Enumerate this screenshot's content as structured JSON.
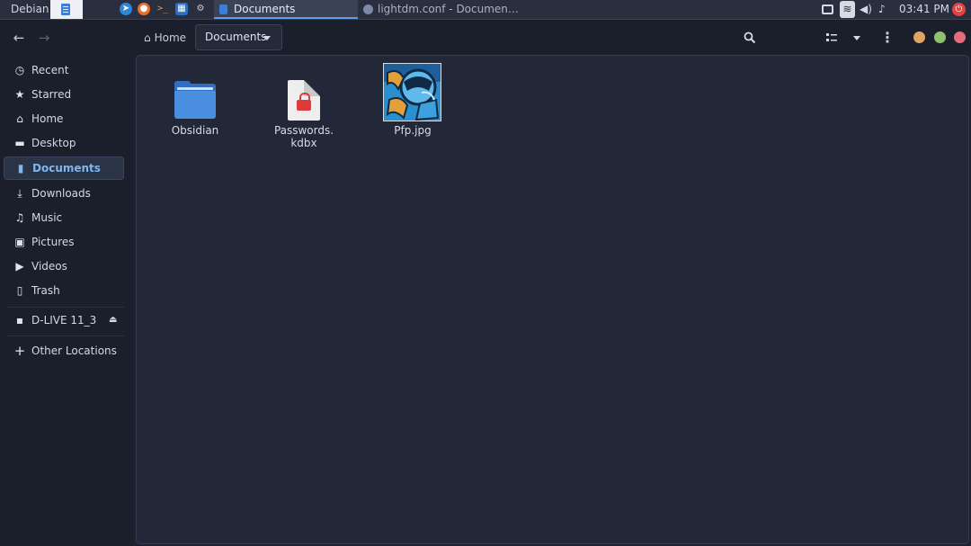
{
  "taskbar": {
    "start_label": "Debian",
    "active_tab": "Documents",
    "inactive_tab": "lightdm.conf - Documen…",
    "clock": "03:41 PM",
    "apps": [
      "files-icon",
      "browser-compass-icon",
      "firefox-icon",
      "terminal-icon",
      "monitor-icon",
      "settings-icon"
    ]
  },
  "header": {
    "back_icon": "←",
    "forward_icon": "→",
    "breadcrumb_home": "Home",
    "breadcrumb_current": "Documents",
    "window_controls": {
      "minimize": "#e0a561",
      "maximize": "#8fc36b",
      "close": "#e66b7b"
    }
  },
  "sidebar": {
    "items": [
      {
        "label": "Recent",
        "icon": "clock-icon",
        "glyph": "◷"
      },
      {
        "label": "Starred",
        "icon": "star-icon",
        "glyph": "★"
      },
      {
        "label": "Home",
        "icon": "home-icon",
        "glyph": "⌂"
      },
      {
        "label": "Desktop",
        "icon": "desktop-icon",
        "glyph": "▬"
      },
      {
        "label": "Documents",
        "icon": "document-icon",
        "glyph": "▮"
      },
      {
        "label": "Downloads",
        "icon": "download-icon",
        "glyph": "⤓"
      },
      {
        "label": "Music",
        "icon": "music-icon",
        "glyph": "♫"
      },
      {
        "label": "Pictures",
        "icon": "picture-icon",
        "glyph": "▣"
      },
      {
        "label": "Videos",
        "icon": "video-icon",
        "glyph": "▶"
      },
      {
        "label": "Trash",
        "icon": "trash-icon",
        "glyph": "▯"
      }
    ],
    "device": {
      "label": "D-LIVE 11_3",
      "glyph": "▪",
      "eject": "⏏"
    },
    "other_locations": {
      "label": "Other Locations",
      "glyph": "+"
    }
  },
  "files": [
    {
      "name": "Obsidian",
      "type": "folder"
    },
    {
      "name": "Passwords.\nkdbx",
      "line1": "Passwords.",
      "line2": "kdbx",
      "type": "locked-document"
    },
    {
      "name": "Pfp.jpg",
      "type": "image"
    }
  ],
  "colors": {
    "accent": "#7fb6f0",
    "background": "#1d2130",
    "content": "#222838"
  }
}
